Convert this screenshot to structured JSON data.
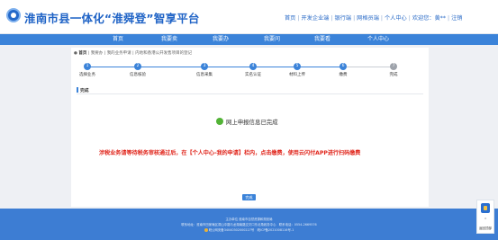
{
  "header": {
    "title": "淮南市县一体化“淮舜登”智享平台",
    "links": [
      "首页",
      "开发企业端",
      "银行端",
      "网格员端",
      "个人中心",
      "欢迎您：黄**",
      "注销"
    ]
  },
  "nav": {
    "items": [
      "首页",
      "我要卖",
      "我要办",
      "我要问",
      "我要看",
      "个人中心"
    ]
  },
  "breadcrumb": {
    "home": "首页",
    "items": [
      "我要办",
      "我的业务申请",
      "内地和香港公开发售项目的登记"
    ]
  },
  "steps": [
    {
      "num": "1",
      "label": "选择业务",
      "done": true
    },
    {
      "num": "2",
      "label": "信息核验",
      "done": true
    },
    {
      "num": "3",
      "label": "信息采集",
      "done": true
    },
    {
      "num": "4",
      "label": "实名认证",
      "done": true
    },
    {
      "num": "5",
      "label": "材料上传",
      "done": true
    },
    {
      "num": "6",
      "label": "缴费",
      "done": true
    },
    {
      "num": "7",
      "label": "完成",
      "done": false
    }
  ],
  "section": {
    "title": "完成"
  },
  "result": {
    "message": "网上申报信息已完成"
  },
  "notice": "涉税业务请等待税务审核通过后，在【个人中心-我的申请】栏内，点击缴费，使用云闪付APP进行扫码缴费",
  "finish_button": "完成",
  "footer": {
    "line1": "主办单位 淮南市自然资源和规划局",
    "line2": "联系地址：淮南市田家庵区洞山中路与龙湖南路交叉口东北角政务中心　联系电话：0554-2669576",
    "line3": "皖公网安备34040302000227号　皖ICP备2021008116号-1"
  },
  "side_widget": {
    "label": "返回顶部"
  },
  "colors": {
    "brand": "#1f63c6",
    "nav": "#3b83d9",
    "notice": "#e0251b",
    "success": "#52b336"
  }
}
